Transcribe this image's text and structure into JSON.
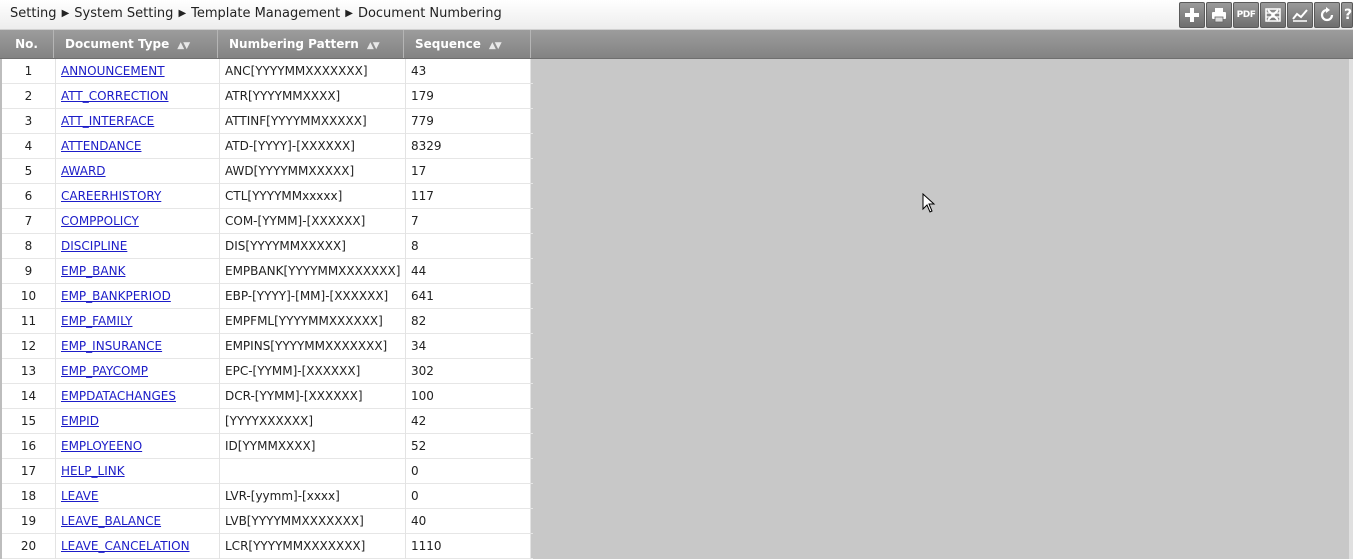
{
  "breadcrumb": [
    "Setting",
    "System Setting",
    "Template Management",
    "Document Numbering"
  ],
  "breadcrumb_separator": "▶",
  "toolbar": {
    "add_icon": "plus-icon",
    "print_icon": "printer-icon",
    "pdf_label": "PDF",
    "excel_icon": "spreadsheet-icon",
    "chart_icon": "chart-icon",
    "refresh_icon": "refresh-icon",
    "help_icon": "help-icon",
    "help_label": "?"
  },
  "columns": {
    "no": "No.",
    "type": "Document Type",
    "pattern": "Numbering Pattern",
    "sequence": "Sequence",
    "sort_glyph": "▲▼"
  },
  "rows": [
    {
      "no": "1",
      "type": "ANNOUNCEMENT",
      "pattern": "ANC[YYYYMMXXXXXXX]",
      "sequence": "43"
    },
    {
      "no": "2",
      "type": "ATT_CORRECTION",
      "pattern": "ATR[YYYYMMXXXX]",
      "sequence": "179"
    },
    {
      "no": "3",
      "type": "ATT_INTERFACE",
      "pattern": "ATTINF[YYYYMMXXXXX]",
      "sequence": "779"
    },
    {
      "no": "4",
      "type": "ATTENDANCE",
      "pattern": "ATD-[YYYY]-[XXXXXX]",
      "sequence": "8329"
    },
    {
      "no": "5",
      "type": "AWARD",
      "pattern": "AWD[YYYYMMXXXXX]",
      "sequence": "17"
    },
    {
      "no": "6",
      "type": "CAREERHISTORY",
      "pattern": "CTL[YYYYMMxxxxx]",
      "sequence": "117"
    },
    {
      "no": "7",
      "type": "COMPPOLICY",
      "pattern": "COM-[YYMM]-[XXXXXX]",
      "sequence": "7"
    },
    {
      "no": "8",
      "type": "DISCIPLINE",
      "pattern": "DIS[YYYYMMXXXXX]",
      "sequence": "8"
    },
    {
      "no": "9",
      "type": "EMP_BANK",
      "pattern": "EMPBANK[YYYYMMXXXXXXX]",
      "sequence": "44"
    },
    {
      "no": "10",
      "type": "EMP_BANKPERIOD",
      "pattern": "EBP-[YYYY]-[MM]-[XXXXXX]",
      "sequence": "641"
    },
    {
      "no": "11",
      "type": "EMP_FAMILY",
      "pattern": "EMPFML[YYYYMMXXXXXX]",
      "sequence": "82"
    },
    {
      "no": "12",
      "type": "EMP_INSURANCE",
      "pattern": "EMPINS[YYYYMMXXXXXXX]",
      "sequence": "34"
    },
    {
      "no": "13",
      "type": "EMP_PAYCOMP",
      "pattern": "EPC-[YYMM]-[XXXXXX]",
      "sequence": "302"
    },
    {
      "no": "14",
      "type": "EMPDATACHANGES",
      "pattern": "DCR-[YYMM]-[XXXXXX]",
      "sequence": "100"
    },
    {
      "no": "15",
      "type": "EMPID",
      "pattern": "[YYYYXXXXXX]",
      "sequence": "42"
    },
    {
      "no": "16",
      "type": "EMPLOYEENO",
      "pattern": "ID[YYMMXXXX]",
      "sequence": "52"
    },
    {
      "no": "17",
      "type": "HELP_LINK",
      "pattern": "",
      "sequence": "0"
    },
    {
      "no": "18",
      "type": "LEAVE",
      "pattern": "LVR-[yymm]-[xxxx]",
      "sequence": "0"
    },
    {
      "no": "19",
      "type": "LEAVE_BALANCE",
      "pattern": "LVB[YYYYMMXXXXXXX]",
      "sequence": "40"
    },
    {
      "no": "20",
      "type": "LEAVE_CANCELATION",
      "pattern": "LCR[YYYYMMXXXXXXX]",
      "sequence": "1110"
    }
  ]
}
